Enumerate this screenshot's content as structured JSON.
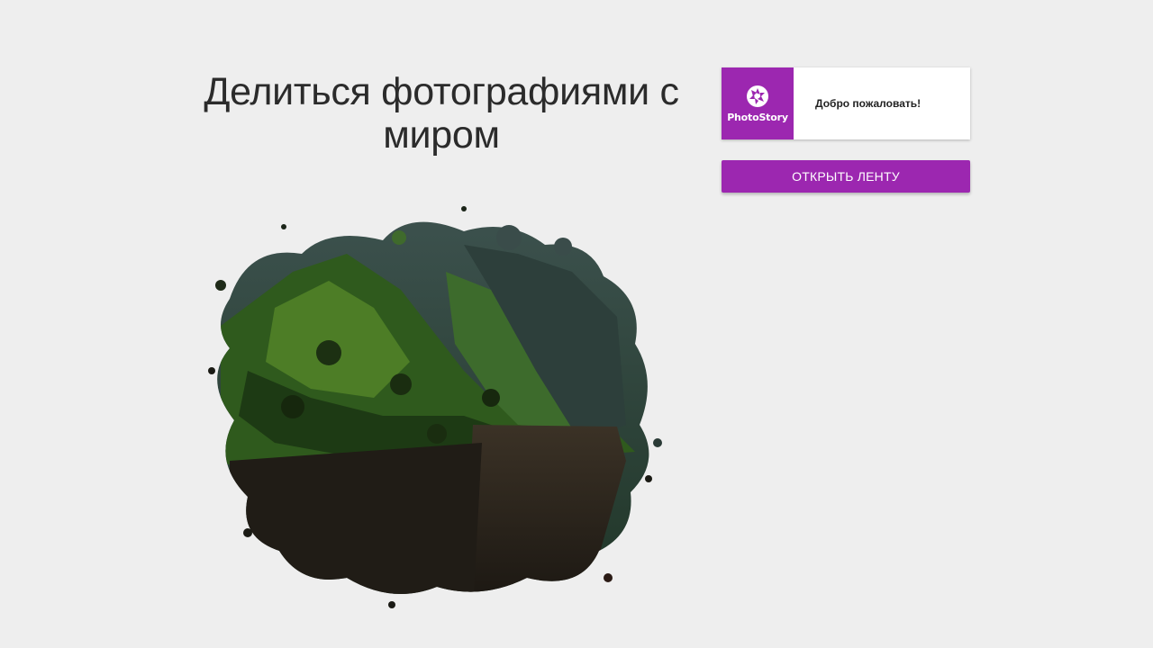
{
  "hero": {
    "title_line1": "Делиться фотографиями с",
    "title_line2": "миром",
    "image_icon": "mountain-landscape-splash-image"
  },
  "welcome_card": {
    "logo_icon": "camera-aperture-icon",
    "logo_text": "PhotoStory",
    "greeting": "Добро пожаловать!"
  },
  "actions": {
    "open_feed_label": "ОТКРЫТЬ ЛЕНТУ"
  },
  "colors": {
    "background": "#eeeeee",
    "accent": "#9c27b0",
    "card": "#ffffff",
    "title_text": "#2b2b2b"
  }
}
